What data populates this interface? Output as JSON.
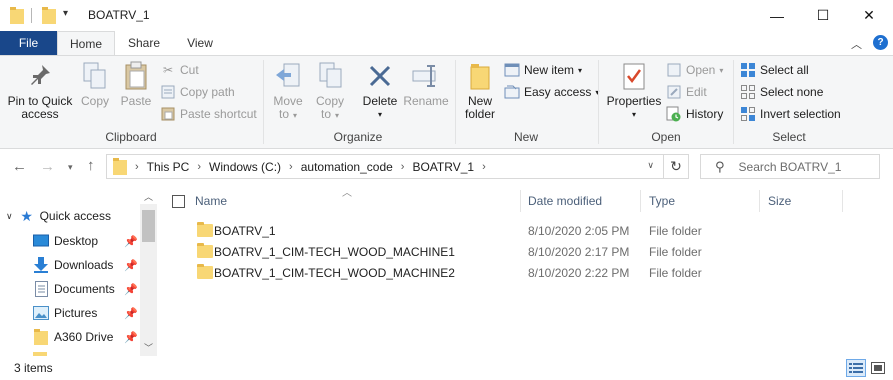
{
  "window": {
    "title": "BOATRV_1",
    "minimize_glyph": "—",
    "maximize_glyph": "☐",
    "close_glyph": "✕"
  },
  "tabs": {
    "file": "File",
    "home": "Home",
    "share": "Share",
    "view": "View"
  },
  "ribbon": {
    "clipboard": {
      "label": "Clipboard",
      "pin_line1": "Pin to Quick",
      "pin_line2": "access",
      "copy": "Copy",
      "paste": "Paste",
      "cut": "Cut",
      "copy_path": "Copy path",
      "paste_shortcut": "Paste shortcut"
    },
    "organize": {
      "label": "Organize",
      "move_line1": "Move",
      "move_line2": "to",
      "copy_line1": "Copy",
      "copy_line2": "to",
      "delete": "Delete",
      "rename": "Rename"
    },
    "new": {
      "label": "New",
      "new_folder_line1": "New",
      "new_folder_line2": "folder",
      "new_item": "New item",
      "easy_access": "Easy access"
    },
    "open": {
      "label": "Open",
      "properties": "Properties",
      "open": "Open",
      "edit": "Edit",
      "history": "History"
    },
    "select": {
      "label": "Select",
      "select_all": "Select all",
      "select_none": "Select none",
      "invert_selection": "Invert selection"
    }
  },
  "address": {
    "crumbs": [
      "This PC",
      "Windows (C:)",
      "automation_code",
      "BOATRV_1"
    ],
    "search_placeholder": "Search BOATRV_1"
  },
  "navpane": {
    "quick_access": "Quick access",
    "items": [
      "Desktop",
      "Downloads",
      "Documents",
      "Pictures",
      "A360 Drive"
    ]
  },
  "columns": {
    "name": "Name",
    "date_modified": "Date modified",
    "type": "Type",
    "size": "Size"
  },
  "files": [
    {
      "name": "BOATRV_1",
      "date": "8/10/2020 2:05 PM",
      "type": "File folder",
      "size": ""
    },
    {
      "name": "BOATRV_1_CIM-TECH_WOOD_MACHINE1",
      "date": "8/10/2020 2:17 PM",
      "type": "File folder",
      "size": ""
    },
    {
      "name": "BOATRV_1_CIM-TECH_WOOD_MACHINE2",
      "date": "8/10/2020 2:22 PM",
      "type": "File folder",
      "size": ""
    }
  ],
  "status": {
    "item_count": "3 items"
  },
  "colors": {
    "file_tab": "#19478a",
    "folder": "#f8d775",
    "accent_blue": "#1e6fd0"
  }
}
